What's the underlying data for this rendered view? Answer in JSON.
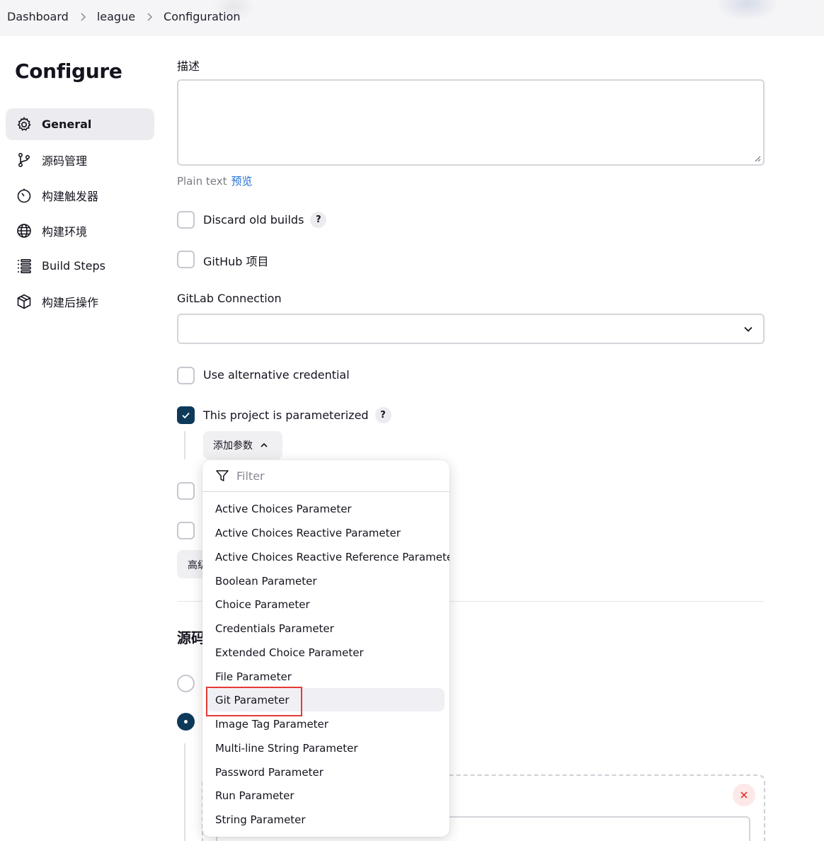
{
  "breadcrumb": [
    "Dashboard",
    "league",
    "Configuration"
  ],
  "sidebar": {
    "title": "Configure",
    "items": [
      {
        "label": "General",
        "icon": "gear-icon",
        "active": true
      },
      {
        "label": "源码管理",
        "icon": "git-branch-icon",
        "active": false
      },
      {
        "label": "构建触发器",
        "icon": "timer-icon",
        "active": false
      },
      {
        "label": "构建环境",
        "icon": "globe-icon",
        "active": false
      },
      {
        "label": "Build Steps",
        "icon": "list-icon",
        "active": false
      },
      {
        "label": "构建后操作",
        "icon": "package-icon",
        "active": false
      }
    ]
  },
  "main": {
    "description_label": "描述",
    "description_value": "",
    "format_label": "Plain text",
    "preview_link": "预览",
    "discard_builds": {
      "label": "Discard old builds",
      "checked": false
    },
    "github_project": {
      "label": "GitHub 项目",
      "checked": false
    },
    "gitlab_connection_label": "GitLab Connection",
    "gitlab_connection_value": "",
    "alt_credential": {
      "label": "Use alternative credential",
      "checked": false
    },
    "parameterized": {
      "label": "This project is parameterized",
      "checked": true
    },
    "add_param_button": "添加参数",
    "advanced_button": "高级",
    "section_heading": "源码管理",
    "help_glyph": "?"
  },
  "dropdown": {
    "filter_placeholder": "Filter",
    "items": [
      "Active Choices Parameter",
      "Active Choices Reactive Parameter",
      "Active Choices Reactive Reference Parameter",
      "Boolean Parameter",
      "Choice Parameter",
      "Credentials Parameter",
      "Extended Choice Parameter",
      "File Parameter",
      "Git Parameter",
      "Image Tag Parameter",
      "Multi-line String Parameter",
      "Password Parameter",
      "Run Parameter",
      "String Parameter"
    ],
    "hovered_item": "Git Parameter"
  },
  "colors": {
    "accent": "#0e3a5a",
    "link": "#1f6fd6",
    "highlight_border": "#e53935"
  }
}
